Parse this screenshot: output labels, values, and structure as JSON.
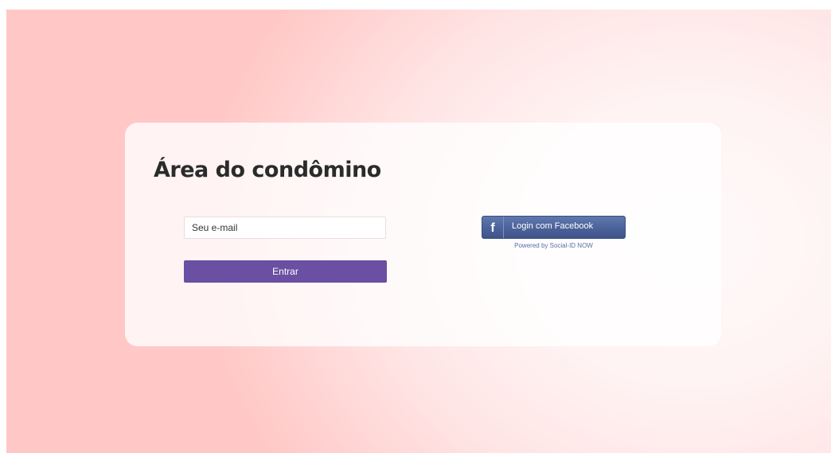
{
  "login": {
    "title": "Área do condômino",
    "email_placeholder": "Seu e-mail",
    "email_value": "",
    "submit_label": "Entrar"
  },
  "social": {
    "facebook_icon": "f",
    "facebook_label": "Login com Facebook",
    "powered_by": "Powered by Social-ID NOW"
  },
  "colors": {
    "submit_button": "#6a4fa3",
    "facebook_button": "#4b629a",
    "background_edge": "#ffc8c6",
    "background_center": "#fffafa"
  }
}
